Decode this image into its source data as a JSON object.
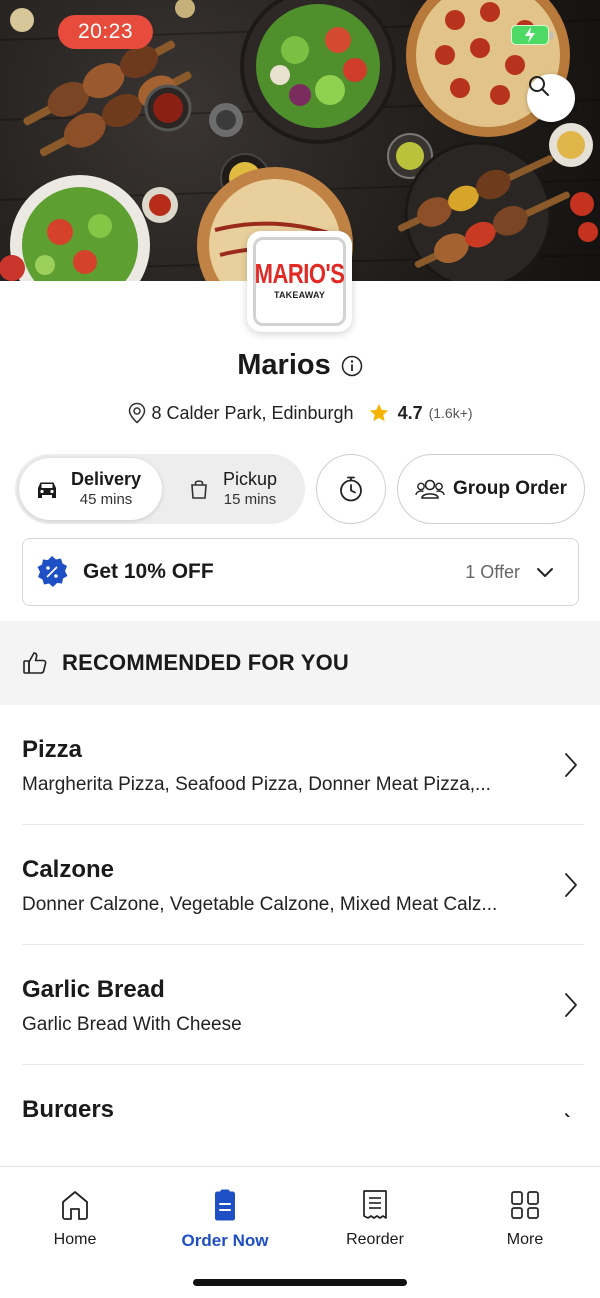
{
  "status_bar": {
    "time": "20:23"
  },
  "hero": {
    "search_icon": "search-icon"
  },
  "logo": {
    "main": "MARIO'S",
    "sub": "TAKEAWAY"
  },
  "store": {
    "name": "Marios",
    "address": "8 Calder Park, Edinburgh",
    "rating": "4.7",
    "rating_count": "(1.6k+)"
  },
  "modes": {
    "delivery": {
      "label": "Delivery",
      "time": "45 mins"
    },
    "pickup": {
      "label": "Pickup",
      "time": "15 mins"
    },
    "group_order": "Group Order"
  },
  "offer": {
    "text": "Get 10% OFF",
    "count": "1 Offer"
  },
  "recommended": {
    "title": "RECOMMENDED FOR YOU"
  },
  "categories": [
    {
      "name": "Pizza",
      "items": "Margherita Pizza, Seafood Pizza, Donner Meat Pizza,..."
    },
    {
      "name": "Calzone",
      "items": "Donner Calzone, Vegetable Calzone, Mixed Meat Calz..."
    },
    {
      "name": "Garlic Bread",
      "items": "Garlic Bread With Cheese"
    },
    {
      "name": "Burgers",
      "items": ""
    }
  ],
  "nav": [
    {
      "label": "Home",
      "icon": "home-icon"
    },
    {
      "label": "Order Now",
      "icon": "order-icon"
    },
    {
      "label": "Reorder",
      "icon": "receipt-icon"
    },
    {
      "label": "More",
      "icon": "grid-icon"
    }
  ],
  "colors": {
    "accent": "#1f4fc4",
    "time_pill": "#e74b3c",
    "logo_red": "#e12a26",
    "star": "#f5b400"
  }
}
